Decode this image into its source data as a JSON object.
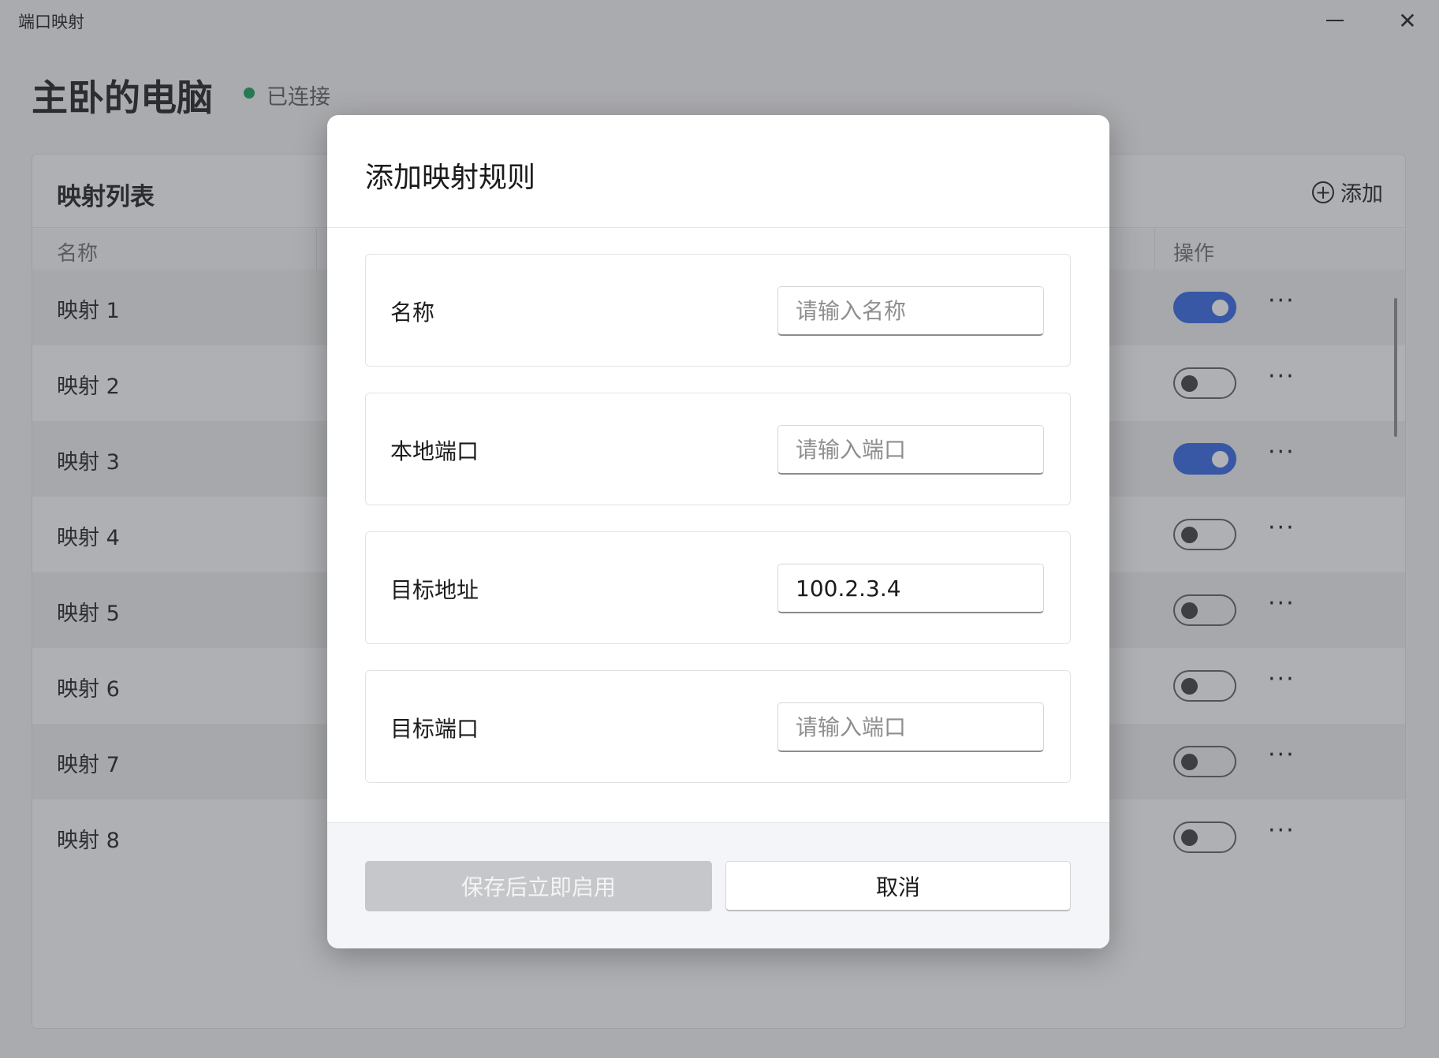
{
  "window": {
    "title": "端口映射",
    "minimize_icon": "minimize-icon",
    "close_icon": "close-icon",
    "close_glyph": "✕"
  },
  "device": {
    "name": "主卧的电脑",
    "status": "已连接",
    "status_color": "#0f9d58"
  },
  "panel": {
    "title": "映射列表",
    "add_label": "添加",
    "add_glyph": "+",
    "columns": {
      "name": "名称",
      "ops": "操作"
    },
    "more_glyph": "···",
    "rows": [
      {
        "name": "映射 1",
        "enabled": true
      },
      {
        "name": "映射 2",
        "enabled": false
      },
      {
        "name": "映射 3",
        "enabled": true
      },
      {
        "name": "映射 4",
        "enabled": false
      },
      {
        "name": "映射 5",
        "enabled": false
      },
      {
        "name": "映射 6",
        "enabled": false
      },
      {
        "name": "映射 7",
        "enabled": false
      },
      {
        "name": "映射 8",
        "enabled": false
      }
    ]
  },
  "dialog": {
    "title": "添加映射规则",
    "fields": [
      {
        "label": "名称",
        "placeholder": "请输入名称",
        "value": ""
      },
      {
        "label": "本地端口",
        "placeholder": "请输入端口",
        "value": ""
      },
      {
        "label": "目标地址",
        "placeholder": "",
        "value": "100.2.3.4"
      },
      {
        "label": "目标端口",
        "placeholder": "请输入端口",
        "value": ""
      }
    ],
    "save_label": "保存后立即启用",
    "cancel_label": "取消"
  },
  "colors": {
    "accent": "#2f62e3",
    "overlay": "rgba(70,72,78,0.42)"
  }
}
